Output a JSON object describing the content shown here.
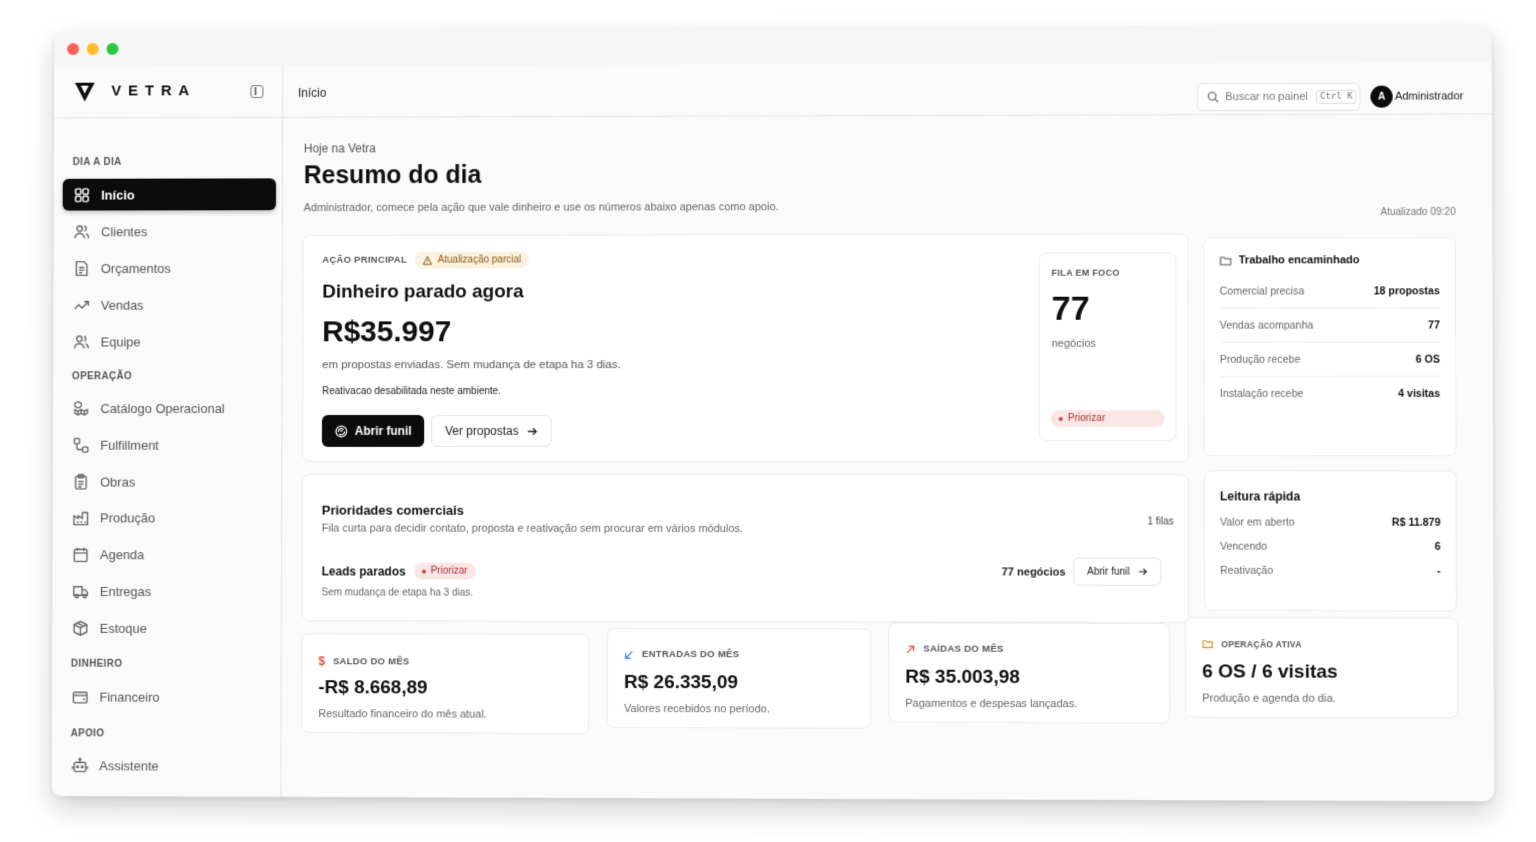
{
  "brand": {
    "name": "VETRA"
  },
  "sidebar": {
    "sections": {
      "dia_a_dia": "DIA A DIA",
      "operacao": "OPERAÇÃO",
      "dinheiro": "DINHEIRO",
      "apoio": "APOIO"
    },
    "items": [
      {
        "label": "Início",
        "icon": "grid-icon"
      },
      {
        "label": "Clientes",
        "icon": "users-icon"
      },
      {
        "label": "Orçamentos",
        "icon": "document-icon"
      },
      {
        "label": "Vendas",
        "icon": "trend-icon"
      },
      {
        "label": "Equipe",
        "icon": "team-icon"
      },
      {
        "label": "Catálogo Operacional",
        "icon": "boxes-icon"
      },
      {
        "label": "Fulfillment",
        "icon": "route-icon"
      },
      {
        "label": "Obras",
        "icon": "clipboard-icon"
      },
      {
        "label": "Produção",
        "icon": "factory-icon"
      },
      {
        "label": "Agenda",
        "icon": "calendar-icon"
      },
      {
        "label": "Entregas",
        "icon": "truck-icon"
      },
      {
        "label": "Estoque",
        "icon": "package-icon"
      },
      {
        "label": "Financeiro",
        "icon": "wallet-icon"
      },
      {
        "label": "Assistente",
        "icon": "bot-icon"
      }
    ]
  },
  "topbar": {
    "breadcrumb": "Início",
    "search_placeholder": "Buscar no painel",
    "search_kbd": "Ctrl K",
    "avatar_initial": "A",
    "user_name": "Administrador"
  },
  "header": {
    "eyebrow": "Hoje na Vetra",
    "title": "Resumo do dia",
    "subtitle": "Administrador, comece pela ação que vale dinheiro e use os números abaixo apenas como apoio.",
    "updated": "Atualizado 09:20"
  },
  "action": {
    "label": "AÇÃO PRINCIPAL",
    "badge": "Atualização parcial",
    "title": "Dinheiro parado agora",
    "amount": "R$35.997",
    "desc": "em propostas enviadas. Sem mudança de etapa ha 3 dias.",
    "note": "Reativacao desabilitada neste ambiente.",
    "btn_primary": "Abrir funil",
    "btn_secondary": "Ver propostas"
  },
  "focus": {
    "label": "FILA EM FOCO",
    "count": "77",
    "unit": "negócios",
    "badge": "Priorizar"
  },
  "work": {
    "title": "Trabalho encaminhado",
    "rows": [
      {
        "k": "Comercial precisa",
        "v": "18 propostas"
      },
      {
        "k": "Vendas acompanha",
        "v": "77"
      },
      {
        "k": "Produção recebe",
        "v": "6 OS"
      },
      {
        "k": "Instalação recebe",
        "v": "4 visitas"
      }
    ]
  },
  "priorities": {
    "title": "Prioridades comerciais",
    "subtitle": "Fila curta para decidir contato, proposta e reativação sem procurar em vários módulos.",
    "queues": "1 filas",
    "lead_title": "Leads parados",
    "lead_badge": "Priorizar",
    "lead_desc": "Sem mudança de etapa ha 3 dias.",
    "lead_count": "77 negócios",
    "lead_btn": "Abrir funil"
  },
  "quick": {
    "title": "Leitura rápida",
    "rows": [
      {
        "k": "Valor em aberto",
        "v": "R$ 11.879"
      },
      {
        "k": "Vencendo",
        "v": "6"
      },
      {
        "k": "Reativação",
        "v": "-"
      }
    ]
  },
  "metrics": [
    {
      "label": "SALDO DO MÊS",
      "value": "-R$ 8.668,89",
      "desc": "Resultado financeiro do mês atual.",
      "icon": "dollar-icon",
      "color": "#d9534f"
    },
    {
      "label": "ENTRADAS DO MÊS",
      "value": "R$ 26.335,09",
      "desc": "Valores recebidos no período.",
      "icon": "arrow-down-left-icon",
      "color": "#3b7bd8"
    },
    {
      "label": "SAÍDAS DO MÊS",
      "value": "R$ 35.003,98",
      "desc": "Pagamentos e despesas lançadas.",
      "icon": "arrow-up-right-icon",
      "color": "#d9534f"
    },
    {
      "label": "OPERAÇÃO ATIVA",
      "value": "6 OS / 6 visitas",
      "desc": "Produção e agenda do dia.",
      "icon": "folder-icon",
      "color": "#e08a1e"
    }
  ]
}
